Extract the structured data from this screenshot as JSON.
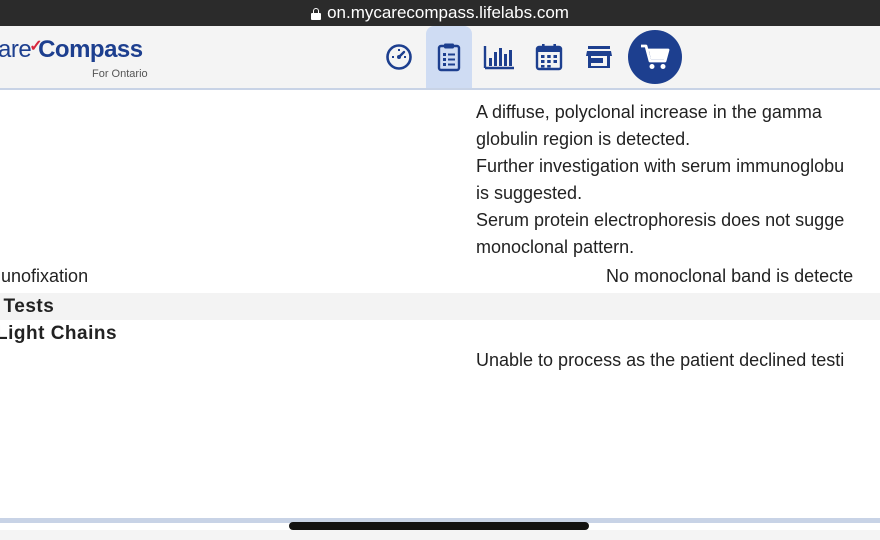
{
  "browser": {
    "url": "on.mycarecompass.lifelabs.com"
  },
  "header": {
    "logo_light": "are",
    "logo_bold": "Compass",
    "logo_sub": "For Ontario",
    "nav_icons": [
      "dashboard-gauge-icon",
      "clipboard-icon",
      "bar-chart-icon",
      "calendar-icon",
      "store-icon",
      "cart-icon"
    ],
    "brand_color": "#1d3f8f",
    "active_tab_color": "#cfdcf3"
  },
  "results": {
    "comment_lines": [
      "A diffuse, polyclonal increase in the gamma",
      "globulin region is detected.",
      "Further investigation with serum immunoglobu",
      "is suggested.",
      "Serum protein electrophoresis does not sugge",
      "monoclonal pattern."
    ],
    "immunofixation_label": "nunofixation",
    "immunofixation_value": "No monoclonal band is detecte",
    "section_heading": "l Tests",
    "light_chains_label": "Light Chains",
    "light_chains_value": "Unable to process as the patient declined testi"
  }
}
